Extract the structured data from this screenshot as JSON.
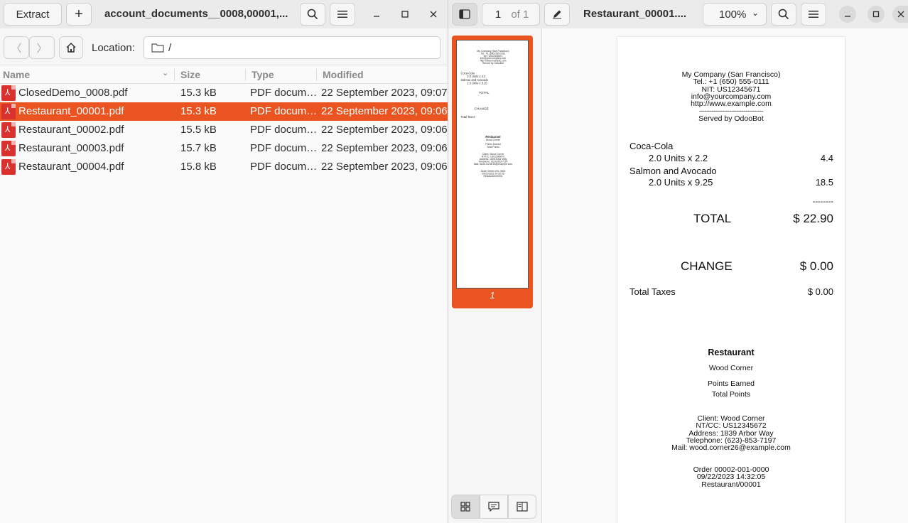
{
  "archive": {
    "extract_label": "Extract",
    "add_label": "+",
    "title": "account_documents__0008,00001,...",
    "location_label": "Location:",
    "location_value": "/",
    "columns": {
      "name": "Name",
      "size": "Size",
      "type": "Type",
      "modified": "Modified"
    },
    "files": [
      {
        "name": "ClosedDemo_0008.pdf",
        "size": "15.3 kB",
        "type": "PDF docum…",
        "modified": "22 September 2023, 09:07"
      },
      {
        "name": "Restaurant_00001.pdf",
        "size": "15.3 kB",
        "type": "PDF docum…",
        "modified": "22 September 2023, 09:06"
      },
      {
        "name": "Restaurant_00002.pdf",
        "size": "15.5 kB",
        "type": "PDF docum…",
        "modified": "22 September 2023, 09:06"
      },
      {
        "name": "Restaurant_00003.pdf",
        "size": "15.7 kB",
        "type": "PDF docum…",
        "modified": "22 September 2023, 09:06"
      },
      {
        "name": "Restaurant_00004.pdf",
        "size": "15.8 kB",
        "type": "PDF docum…",
        "modified": "22 September 2023, 09:06"
      }
    ],
    "selected_index": 1
  },
  "viewer": {
    "page_current": "1",
    "page_total": "of 1",
    "title": "Restaurant_00001....",
    "zoom": "100%",
    "thumb_label": "1"
  },
  "receipt": {
    "company": "My Company (San Francisco)",
    "tel": "Tel.: +1 (650) 555-0111",
    "nit": "NIT: US12345671",
    "email": "info@yourcompany.com",
    "website": "http://www.example.com",
    "divider": "------------------------------------",
    "served_by": "Served by OdooBot",
    "line1_name": "Coca-Cola",
    "line1_qty": "2.0 Units x 2.2",
    "line1_amount": "4.4",
    "line2_name": "Salmon and Avocado",
    "line2_qty": "2.0 Units x 9.25",
    "line2_amount": "18.5",
    "subtotal_divider": "--------",
    "total_label": "TOTAL",
    "total_value": "$ 22.90",
    "change_label": "CHANGE",
    "change_value": "$ 0.00",
    "taxes_label": "Total Taxes",
    "taxes_value": "$ 0.00",
    "section_title": "Restaurant",
    "customer": "Wood Corner",
    "points_earned": "Points Earned",
    "total_points": "Total Points",
    "client": "Client: Wood Corner",
    "ntcc": "NT/CC: US12345672",
    "address": "Address: 1839 Arbor Way",
    "telephone": "Telephone: (623)-853-7197",
    "mail": "Mail: wood.corner26@example.com",
    "order": "Order 00002-001-0000",
    "datetime": "09/22/2023 14:32:05",
    "ref": "Restaurant/00001"
  },
  "colors": {
    "accent": "#e95420",
    "pdf_icon": "#d9322e"
  }
}
